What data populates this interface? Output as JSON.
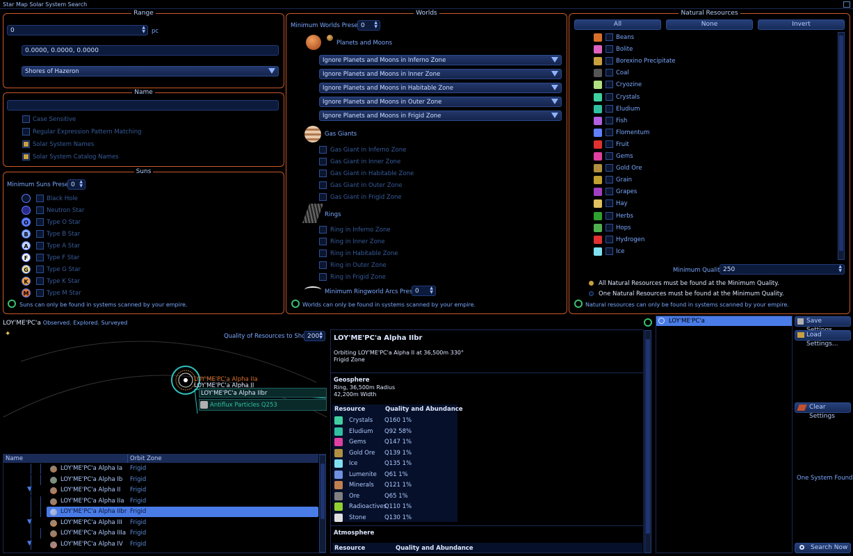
{
  "window": {
    "title": "Star Map Solar System Search"
  },
  "range": {
    "title": "Range",
    "value": "0",
    "unit": "pc",
    "coords": "0.0000, 0.0000, 0.0000",
    "location": "Shores of Hazeron"
  },
  "name": {
    "title": "Name",
    "value": "",
    "options": [
      {
        "label": "Case Sensitive",
        "checked": false
      },
      {
        "label": "Regular Expression Pattern Matching",
        "checked": false
      },
      {
        "label": "Solar System Names",
        "checked": true
      },
      {
        "label": "Solar System Catalog Names",
        "checked": true
      }
    ]
  },
  "suns": {
    "title": "Suns",
    "min_label": "Minimum Suns Present",
    "min_value": "0",
    "types": [
      {
        "label": "Black Hole",
        "glyph": "",
        "color": "#0a1530"
      },
      {
        "label": "Neutron Star",
        "glyph": "",
        "color": "#2b2a8c"
      },
      {
        "label": "Type O Star",
        "glyph": "O",
        "color": "#5a7cff"
      },
      {
        "label": "Type B Star",
        "glyph": "B",
        "color": "#8ab0ff"
      },
      {
        "label": "Type A Star",
        "glyph": "A",
        "color": "#c8d8ff"
      },
      {
        "label": "Type F Star",
        "glyph": "F",
        "color": "#f4f4f0"
      },
      {
        "label": "Type G Star",
        "glyph": "G",
        "color": "#f0e090"
      },
      {
        "label": "Type K Star",
        "glyph": "K",
        "color": "#f0a040"
      },
      {
        "label": "Type M Star",
        "glyph": "M",
        "color": "#e07030"
      }
    ],
    "note": "Suns can only be found in systems scanned by your empire."
  },
  "worlds": {
    "title": "Worlds",
    "min_label": "Minimum Worlds Present",
    "min_value": "0",
    "planets_label": "Planets and Moons",
    "zone_selects": [
      "Ignore Planets and Moons in Inferno Zone",
      "Ignore Planets and Moons in Inner Zone",
      "Ignore Planets and Moons in Habitable Zone",
      "Ignore Planets and Moons in Outer Zone",
      "Ignore Planets and Moons in Frigid Zone"
    ],
    "gas_label": "Gas Giants",
    "gas_options": [
      "Gas Giant in Inferno Zone",
      "Gas Giant in Inner Zone",
      "Gas Giant in Habitable Zone",
      "Gas Giant in Outer Zone",
      "Gas Giant in Frigid Zone"
    ],
    "rings_label": "Rings",
    "ring_options": [
      "Ring in Inferno Zone",
      "Ring in Inner Zone",
      "Ring in Habitable Zone",
      "Ring in Outer Zone",
      "Ring in Frigid Zone"
    ],
    "ringworld_label": "Minimum Ringworld Arcs Present",
    "ringworld_value": "0",
    "note": "Worlds can only be found in systems scanned by your empire."
  },
  "resources": {
    "title": "Natural Resources",
    "btn_all": "All",
    "btn_none": "None",
    "btn_invert": "Invert",
    "items": [
      {
        "label": "Beans",
        "color": "#d8702a"
      },
      {
        "label": "Bolite",
        "color": "#e060c0"
      },
      {
        "label": "Borexino Precipitate",
        "color": "#c8a040"
      },
      {
        "label": "Coal",
        "color": "#555555"
      },
      {
        "label": "Cryozine",
        "color": "#b0e080"
      },
      {
        "label": "Crystals",
        "color": "#40d0a0"
      },
      {
        "label": "Eludium",
        "color": "#30c0a0"
      },
      {
        "label": "Fish",
        "color": "#b060e0"
      },
      {
        "label": "Flomentum",
        "color": "#6080ff"
      },
      {
        "label": "Fruit",
        "color": "#e03030"
      },
      {
        "label": "Gems",
        "color": "#e040a0"
      },
      {
        "label": "Gold Ore",
        "color": "#b09040"
      },
      {
        "label": "Grain",
        "color": "#c0a030"
      },
      {
        "label": "Grapes",
        "color": "#a040c0"
      },
      {
        "label": "Hay",
        "color": "#e0c060"
      },
      {
        "label": "Herbs",
        "color": "#30a030"
      },
      {
        "label": "Hops",
        "color": "#50b050"
      },
      {
        "label": "Hydrogen",
        "color": "#e03030"
      },
      {
        "label": "Ice",
        "color": "#80e0f0"
      }
    ],
    "min_quality_label": "Minimum Quality",
    "min_quality_value": "250",
    "radio_all": "All Natural Resources must be found at the Minimum Quality.",
    "radio_one": "One Natural Resources must be found at the Minimum Quality.",
    "note": "Natural resources can only be found in systems scanned by your empire."
  },
  "system": {
    "name": "LOY'ME'PC'a",
    "status": "Observed. Explored. Surveyed",
    "quality_label": "Quality of Resources to Show",
    "quality_value": "200",
    "map_labels": {
      "a2a": "LOY'ME'PC'a Alpha IIa",
      "a2": "LOY'ME'PC'a Alpha II",
      "a2br": "LOY'ME'PC'a Alpha IIbr",
      "antiflux": "Antiflux Particles Q253"
    }
  },
  "tree": {
    "col_name": "Name",
    "col_zone": "Orbit Zone",
    "rows": [
      {
        "name": "LOY'ME'PC'a Alpha Ia",
        "zone": "Frigid",
        "indent": 1,
        "color": "#c07030",
        "selected": false
      },
      {
        "name": "LOY'ME'PC'a Alpha Ib",
        "zone": "Frigid",
        "indent": 1,
        "color": "#6a9a70",
        "selected": false
      },
      {
        "name": "LOY'ME'PC'a Alpha II",
        "zone": "Frigid",
        "indent": 0,
        "color": "#e07030",
        "selected": false
      },
      {
        "name": "LOY'ME'PC'a Alpha IIa",
        "zone": "Frigid",
        "indent": 1,
        "color": "#c07030",
        "selected": false
      },
      {
        "name": "LOY'ME'PC'a Alpha IIbr",
        "zone": "Frigid",
        "indent": 1,
        "color": "#9aa0b0",
        "selected": true
      },
      {
        "name": "LOY'ME'PC'a Alpha III",
        "zone": "Frigid",
        "indent": 0,
        "color": "#e08030",
        "selected": false
      },
      {
        "name": "LOY'ME'PC'a Alpha IIIa",
        "zone": "Frigid",
        "indent": 1,
        "color": "#c07030",
        "selected": false
      },
      {
        "name": "LOY'ME'PC'a Alpha IV",
        "zone": "Frigid",
        "indent": 0,
        "color": "#e08070",
        "selected": false
      }
    ]
  },
  "detail": {
    "title": "LOY'ME'PC'a Alpha IIbr",
    "orbit": "Orbiting LOY'ME'PC'a Alpha II at 36,500m 330°",
    "zone": "Frigid Zone",
    "geo_title": "Geosphere",
    "geo_line1": "Ring, 36,500m Radius",
    "geo_line2": "42,200m Width",
    "col_resource": "Resource",
    "col_quality": "Quality and Abundance",
    "resources": [
      {
        "name": "Crystals",
        "q": "Q160 1%",
        "color": "#40d0a0"
      },
      {
        "name": "Eludium",
        "q": "Q92 58%",
        "color": "#30c0a0"
      },
      {
        "name": "Gems",
        "q": "Q147 1%",
        "color": "#e040a0"
      },
      {
        "name": "Gold Ore",
        "q": "Q139 1%",
        "color": "#b09040"
      },
      {
        "name": "Ice",
        "q": "Q135 1%",
        "color": "#80e0f0"
      },
      {
        "name": "Lumenite",
        "q": "Q61 1%",
        "color": "#7090e0"
      },
      {
        "name": "Minerals",
        "q": "Q121 1%",
        "color": "#c08050"
      },
      {
        "name": "Ore",
        "q": "Q65 1%",
        "color": "#808080"
      },
      {
        "name": "Radioactives",
        "q": "Q110 1%",
        "color": "#90d030"
      },
      {
        "name": "Stone",
        "q": "Q130 1%",
        "color": "#e0e0e0"
      }
    ],
    "atmo_title": "Atmosphere",
    "atmo_col_resource": "Resource",
    "atmo_col_quality": "Quality and Abundance"
  },
  "results": {
    "item": "LOY'ME'PC'a",
    "save": "Save Settings...",
    "load": "Load Settings...",
    "clear": "Clear Settings",
    "found": "One System Found",
    "search": "Search Now"
  }
}
